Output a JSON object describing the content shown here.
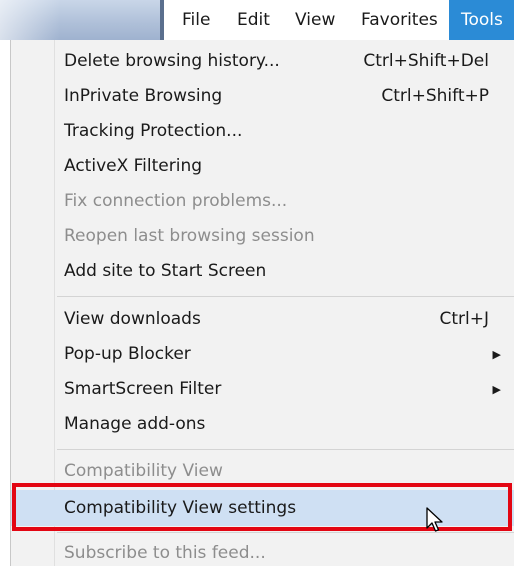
{
  "menubar": {
    "items": [
      {
        "label": "File"
      },
      {
        "label": "Edit"
      },
      {
        "label": "View"
      },
      {
        "label": "Favorites"
      },
      {
        "label": "Tools",
        "active": true
      }
    ]
  },
  "dropdown": {
    "items": [
      {
        "label": "Delete browsing history...",
        "shortcut": "Ctrl+Shift+Del"
      },
      {
        "label": "InPrivate Browsing",
        "shortcut": "Ctrl+Shift+P"
      },
      {
        "label": "Tracking Protection..."
      },
      {
        "label": "ActiveX Filtering"
      },
      {
        "label": "Fix connection problems...",
        "disabled": true
      },
      {
        "label": "Reopen last browsing session",
        "disabled": true
      },
      {
        "label": "Add site to Start Screen"
      },
      {
        "label": "View downloads",
        "shortcut": "Ctrl+J"
      },
      {
        "label": "Pop-up Blocker",
        "submenu": true
      },
      {
        "label": "SmartScreen Filter",
        "submenu": true
      },
      {
        "label": "Manage add-ons"
      },
      {
        "label": "Compatibility View",
        "disabled": true
      },
      {
        "label": "Compatibility View settings",
        "highlighted": true
      },
      {
        "label": "Subscribe to this feed...",
        "disabled": true
      }
    ]
  },
  "colors": {
    "accent": "#2b8bd6",
    "highlight": "#cfe0f3",
    "annotation": "#e30613",
    "disabled_text": "#8d8d8d"
  },
  "icons": {
    "submenu": "triangle-right-icon",
    "cursor": "mouse-pointer-icon"
  }
}
